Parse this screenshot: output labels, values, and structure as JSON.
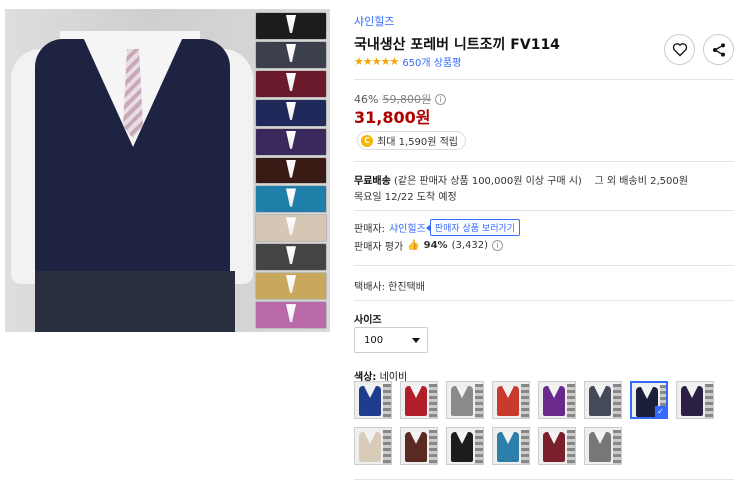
{
  "product": {
    "brand": "샤인힐즈",
    "title": "국내생산 포레버 니트조끼 FV114",
    "stars": "★★★★★",
    "review_count": "650개 상품평",
    "discount_rate": "46%",
    "original_price": "59,800원",
    "sale_price": "31,800원",
    "reward_coin": "C",
    "reward_text": "최대 1,590원 적립"
  },
  "shipping": {
    "label": "무료배송",
    "condition": "(같은 판매자 상품 100,000원 이상 구매 시)",
    "other_fee": "그 외 배송비 2,500원",
    "eta": "목요일 12/22 도착 예정"
  },
  "seller": {
    "label": "판매자:",
    "name": "샤인힐즈",
    "tooltip": "판매자 상품 보러가기",
    "rating_label": "판매자 평가",
    "rating_icon": "👍",
    "rating_pct": "94%",
    "rating_count": "(3,432)"
  },
  "carrier": "택배사: 한진택배",
  "size": {
    "label": "사이즈",
    "selected": "100"
  },
  "color": {
    "label": "색상:",
    "selected": "네이비",
    "options": [
      {
        "color": "#1f3c8f"
      },
      {
        "color": "#b01e2a"
      },
      {
        "color": "#8a8a8a"
      },
      {
        "color": "#c73a2c"
      },
      {
        "color": "#6a2a8c"
      },
      {
        "color": "#444a58"
      },
      {
        "color": "#1a1f3a",
        "selected": true
      },
      {
        "color": "#2c1f44"
      },
      {
        "color": "#d8cbb8"
      },
      {
        "color": "#5a2a22"
      },
      {
        "color": "#1c1c1c"
      },
      {
        "color": "#2c7fa8"
      },
      {
        "color": "#7a1f2c"
      },
      {
        "color": "#777"
      }
    ]
  },
  "strip_colors": [
    "#1c1c1c",
    "#3c3f4c",
    "#6b1a2c",
    "#1f2a5a",
    "#3a2a5c",
    "#3a1a14",
    "#1f7fa8",
    "#d6c7b5",
    "#444",
    "#c7a85c",
    "#b86aa8"
  ]
}
